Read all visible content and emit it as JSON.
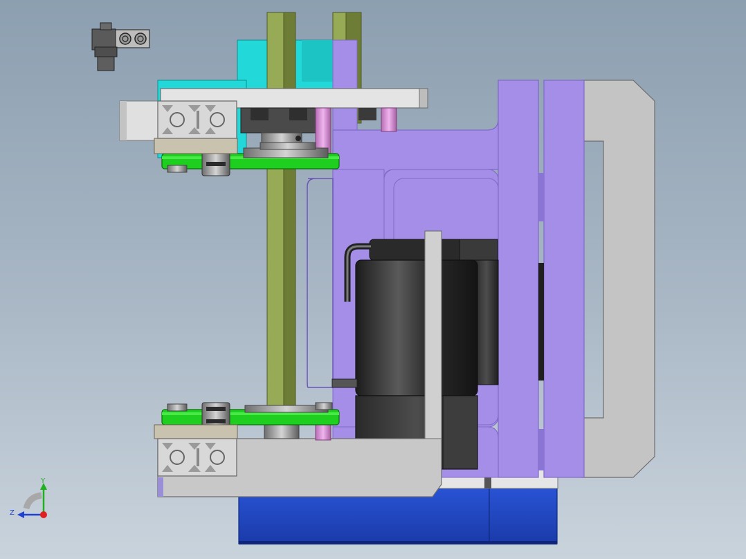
{
  "viewport": {
    "background_top": "#8c9fb0",
    "background_bottom": "#c9d3dc"
  },
  "colors": {
    "lavender_plate": "#a48ee8",
    "lavender_edge": "#7f69c8",
    "cyan_block": "#22d8d8",
    "olive_rail": "#97aa55",
    "olive_rail_dark": "#6d7d36",
    "grey_frame": "#c8c8c8",
    "grey_frame_edge": "#777777",
    "green_belt": "#1fcf1f",
    "blue_base": "#2147c6",
    "motor_dark": "#2e2e2e",
    "pink_shaft": "#e49ae0",
    "khaki_block": "#c9c2ae"
  },
  "triad": {
    "y_label": "Y",
    "z_label": "Z",
    "x_dot_color": "#e02020",
    "y_color": "#20b020",
    "z_color": "#2040d0"
  },
  "components": [
    "top-left-bracket",
    "upper-belt-pulley-assembly",
    "lower-belt-pulley-assembly",
    "linear-guide-rails",
    "lavender-c-frame",
    "grey-c-frame",
    "servo-motor",
    "blue-base-block"
  ]
}
